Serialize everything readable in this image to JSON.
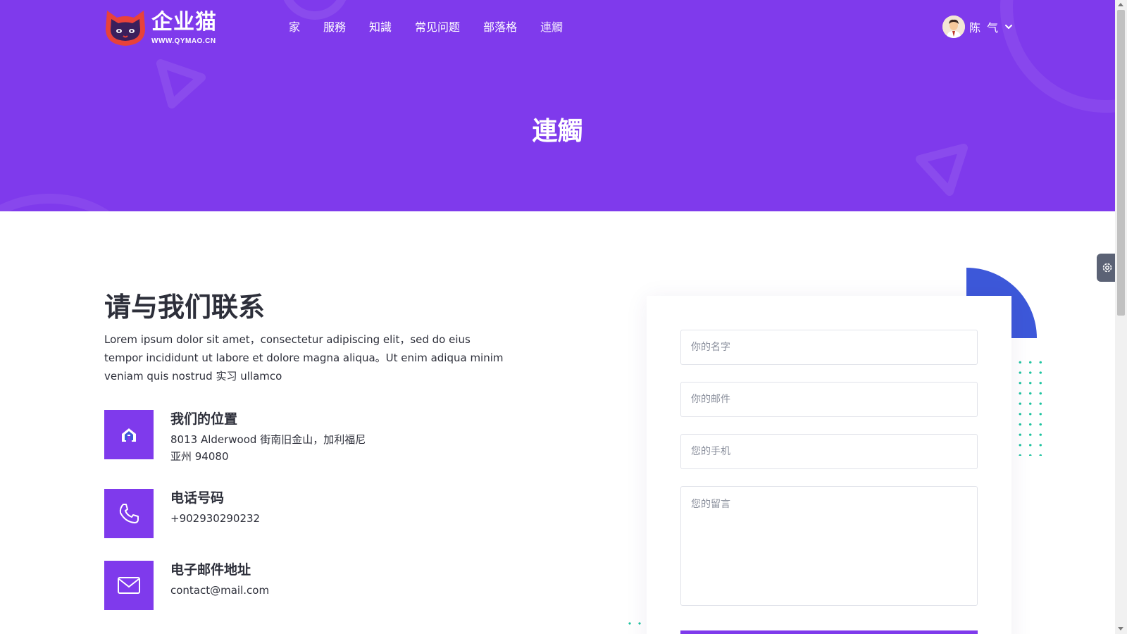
{
  "brand": {
    "name": "企业猫",
    "url": "WWW.QYMAO.CN"
  },
  "nav": {
    "items": [
      {
        "label": "家"
      },
      {
        "label": "服務"
      },
      {
        "label": "知識"
      },
      {
        "label": "常见问题"
      },
      {
        "label": "部落格"
      },
      {
        "label": "連觸"
      }
    ],
    "active_index": 5
  },
  "user": {
    "name": "陈 气",
    "avatar_icon": "user-avatar"
  },
  "page_title": "連觸",
  "contact": {
    "title": "请与我们联系",
    "intro": "Lorem ipsum dolor sit amet，consectetur adipiscing elit，sed do eius tempor incididunt ut labore et dolore magna aliqua。Ut enim adiqua minim veniam quis nostrud 实习 ullamco",
    "items": [
      {
        "icon": "home-icon",
        "title": "我们的位置",
        "text": "8013 Alderwood 街南旧金山，加利福尼亚州 94080"
      },
      {
        "icon": "phone-icon",
        "title": "电话号码",
        "text": "+902930290232"
      },
      {
        "icon": "mail-icon",
        "title": "电子邮件地址",
        "text": "contact@mail.com"
      }
    ]
  },
  "form": {
    "name_placeholder": "你的名字",
    "email_placeholder": "你的邮件",
    "phone_placeholder": "您的手机",
    "message_placeholder": "您的留言"
  },
  "colors": {
    "primary": "#7f3aec",
    "accent_blue": "#3d58d9",
    "dots": "#1fc4a0",
    "text": "#2d2f3a"
  }
}
